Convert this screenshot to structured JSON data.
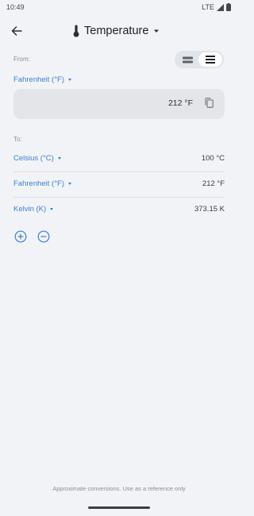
{
  "status_bar": {
    "time": "10:49",
    "network": "LTE"
  },
  "app_bar": {
    "title": "Temperature",
    "title_icon": "thermometer-icon"
  },
  "from_section": {
    "label": "From:",
    "unit": "Fahrenheit (°F)",
    "value": "212 °F"
  },
  "to_section": {
    "label": "To:",
    "rows": [
      {
        "unit": "Celsius (°C)",
        "value": "100 °C"
      },
      {
        "unit": "Fahrenheit (°F)",
        "value": "212 °F"
      },
      {
        "unit": "Kelvin (K)",
        "value": "373.15 K"
      }
    ]
  },
  "layout_toggle": {
    "options": [
      "compact-view-icon",
      "list-view-icon"
    ],
    "selected": "list-view-icon"
  },
  "footer": {
    "note": "Approximate conversions. Use as a reference only"
  },
  "colors": {
    "accent": "#3b7fd8",
    "background": "#f1f3f6",
    "card": "#e3e5e9"
  }
}
